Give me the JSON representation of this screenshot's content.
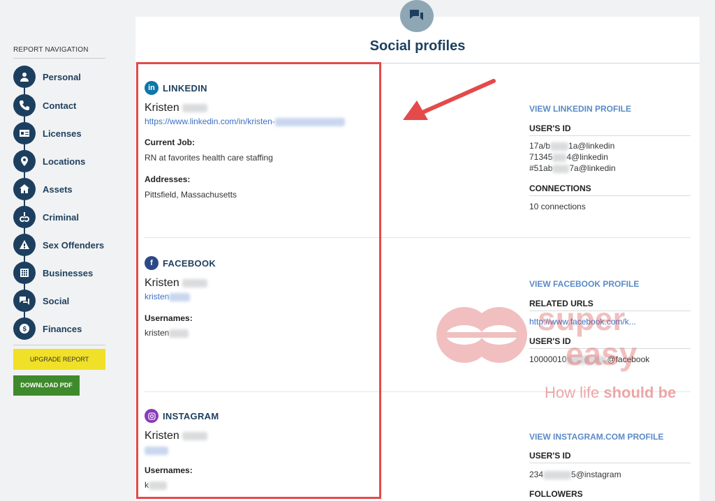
{
  "sidebar": {
    "title": "REPORT NAVIGATION",
    "items": [
      {
        "label": "Personal",
        "icon": "person-icon"
      },
      {
        "label": "Contact",
        "icon": "phone-icon"
      },
      {
        "label": "Licenses",
        "icon": "id-card-icon"
      },
      {
        "label": "Locations",
        "icon": "map-pin-icon"
      },
      {
        "label": "Assets",
        "icon": "house-icon"
      },
      {
        "label": "Criminal",
        "icon": "handcuffs-icon"
      },
      {
        "label": "Sex Offenders",
        "icon": "warning-icon"
      },
      {
        "label": "Businesses",
        "icon": "building-icon"
      },
      {
        "label": "Social",
        "icon": "chat-icon"
      },
      {
        "label": "Finances",
        "icon": "dollar-icon"
      }
    ],
    "upgrade_label": "UPGRADE REPORT",
    "download_label": "DOWNLOAD PDF"
  },
  "main": {
    "title": "Social profiles",
    "linkedin": {
      "network": "LINKEDIN",
      "name": "Kristen",
      "url": "https://www.linkedin.com/in/kristen-",
      "job_label": "Current Job:",
      "job_value": "RN at favorites health care staffing",
      "addresses_label": "Addresses:",
      "address_value": "Pittsfield, Massachusetts",
      "view_link": "VIEW LINKEDIN PROFILE",
      "userid_label": "USER'S ID",
      "ids": [
        "17a/b",
        "1a@linkedin",
        "71345",
        "4@linkedin",
        "#51ab",
        "7a@linkedin"
      ],
      "connections_label": "CONNECTIONS",
      "connections_value": "10 connections"
    },
    "facebook": {
      "network": "FACEBOOK",
      "name": "Kristen",
      "handle": "kristen",
      "usernames_label": "Usernames:",
      "username_value": "kristen",
      "view_link": "VIEW FACEBOOK PROFILE",
      "related_label": "RELATED URLS",
      "related_url": "http://www.facebook.com/k...",
      "userid_label": "USER'S ID",
      "id_start": "10000010",
      "id_end": "@facebook"
    },
    "instagram": {
      "network": "INSTAGRAM",
      "name": "Kristen",
      "usernames_label": "Usernames:",
      "username_value": "k",
      "view_link": "VIEW INSTAGRAM.COM PROFILE",
      "userid_label": "USER'S ID",
      "id_start": "234",
      "id_end": "5@instagram",
      "followers_label": "FOLLOWERS"
    }
  },
  "watermark": {
    "brand_top": "super",
    "brand_bottom": "easy",
    "tagline_a": "How life ",
    "tagline_b": "should be"
  },
  "colors": {
    "navy": "#1d3f5f",
    "link": "#3a6fc4",
    "highlight": "#e44a4a",
    "upgrade": "#f0e027",
    "download": "#3f8a2c"
  }
}
